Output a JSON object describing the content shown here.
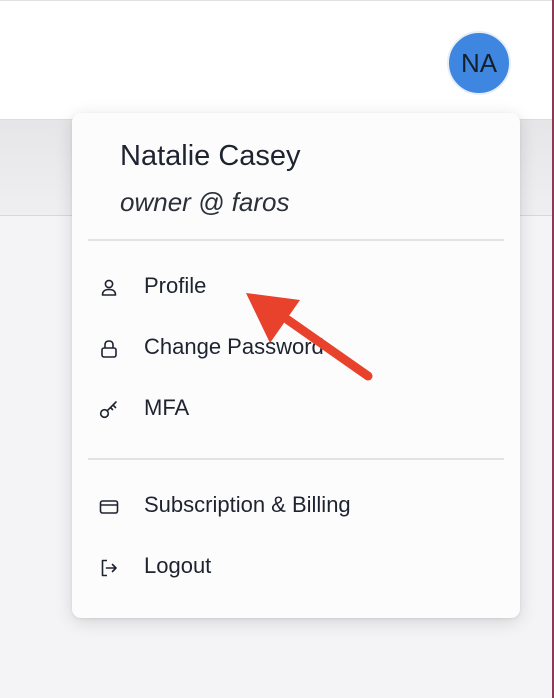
{
  "header": {
    "avatar_initials": "NA",
    "avatar_color": "#3f86e0"
  },
  "user_menu": {
    "name": "Natalie Casey",
    "role": "owner @ faros",
    "items": [
      {
        "label": "Profile",
        "icon": "user-icon"
      },
      {
        "label": "Change Password",
        "icon": "lock-icon"
      },
      {
        "label": "MFA",
        "icon": "key-icon"
      },
      {
        "label": "Subscription & Billing",
        "icon": "credit-card-icon"
      },
      {
        "label": "Logout",
        "icon": "logout-icon"
      }
    ]
  },
  "annotation": {
    "arrow_color": "#e8412c"
  }
}
